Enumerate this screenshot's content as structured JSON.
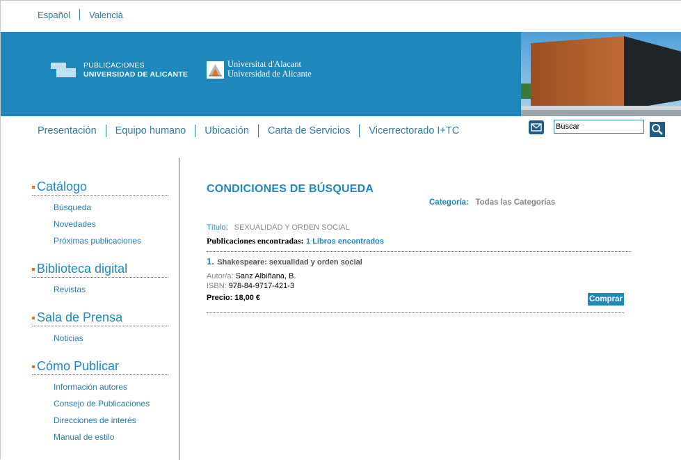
{
  "languages": [
    "Español",
    "Valencià"
  ],
  "header": {
    "pub_line1": "PUBLICACIONES",
    "pub_line2": "UNIVERSIDAD DE ALICANTE",
    "ua_line1": "Universitat d'Alacant",
    "ua_line2": "Universidad de Alicante"
  },
  "nav": [
    "Presentación",
    "Equipo humano",
    "Ubicación",
    "Carta de Servicios",
    "Vicerrectorado I+TC"
  ],
  "search": {
    "value": "Buscar"
  },
  "sidebar": [
    {
      "title": "Catálogo",
      "items": [
        "Búsqueda",
        "Novedades",
        "Próximas publicaciones"
      ]
    },
    {
      "title": "Biblioteca digital",
      "items": [
        "Revistas"
      ]
    },
    {
      "title": "Sala de Prensa",
      "items": [
        "Noticias"
      ]
    },
    {
      "title": "Cómo Publicar",
      "items": [
        "Información autores",
        "Consejo de Publicaciones",
        "Direcciones de interés",
        "Manual de estilo"
      ]
    }
  ],
  "content": {
    "title": "CONDICIONES DE BÚSQUEDA",
    "category_label": "Categoría:",
    "category_value": "Todas las Categorías",
    "titulo_label": "Título:",
    "titulo_value": "SEXUALIDAD Y ORDEN SOCIAL",
    "found_label": "Publicaciones encontradas:",
    "found_value": "1 Libros encontrados",
    "result": {
      "number": "1.",
      "title": "Shakespeare: sexualidad y orden social",
      "author_label": "Autor/a:",
      "author": "Sanz Albiñana, B.",
      "isbn_label": "ISBN:",
      "isbn": "978-84-9717-421-3",
      "price": "Precio: 18,00 €",
      "buy_label": "Comprar"
    }
  },
  "colors": {
    "brand_blue": "#1e88bd",
    "link_blue": "#2f7aa1",
    "accent_orange": "#e2731f"
  }
}
